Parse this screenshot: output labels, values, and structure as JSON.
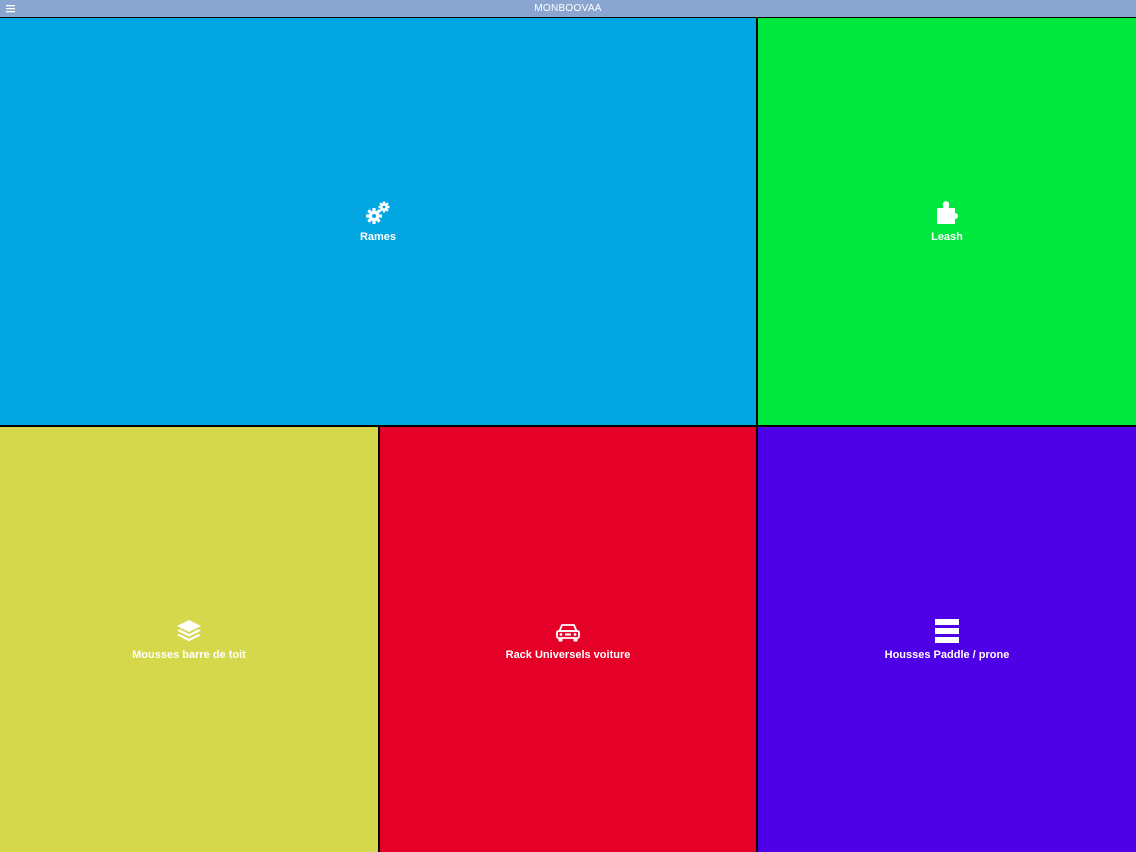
{
  "header": {
    "title": "MONBOOVAA",
    "menu_icon": "hamburger-menu-icon",
    "background": "#8aa6d0"
  },
  "tiles": [
    {
      "label": "Rames",
      "icon": "gears-icon",
      "color": "#02a6e3"
    },
    {
      "label": "Leash",
      "icon": "puzzle-icon",
      "color": "#00e83e"
    },
    {
      "label": "Mousses barre de toit",
      "icon": "layers-icon",
      "color": "#d4d84a"
    },
    {
      "label": "Rack Universels voiture",
      "icon": "car-icon",
      "color": "#e50027"
    },
    {
      "label": "Housses Paddle / prone",
      "icon": "stacked-bars-icon",
      "color": "#4e00e6"
    }
  ]
}
